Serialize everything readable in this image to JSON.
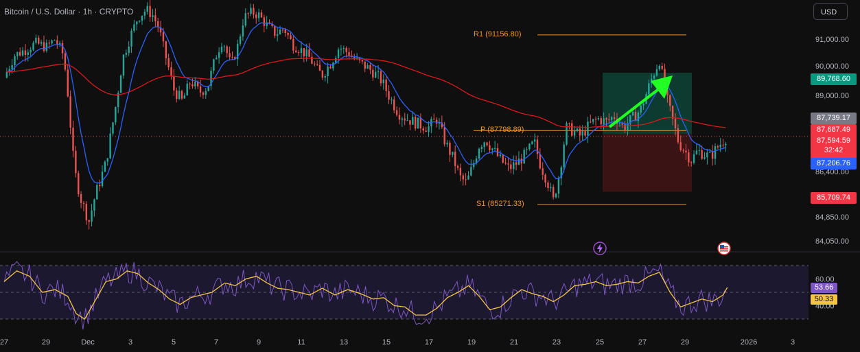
{
  "symbol_title": "Bitcoin / U.S. Dollar · 1h · CRYPTO",
  "currency": "USD",
  "colors": {
    "background": "#0f0f0f",
    "up": "#26a69a",
    "down": "#ef5350",
    "ema_fast": "#2962ff",
    "ema_slow": "#e0181b",
    "pivot": "#f7931a",
    "rsi": "#7e57c2",
    "rsi_ma": "#f5c542",
    "arrow": "#22ff22",
    "target_zone": "#0d3b2f",
    "stop_zone": "#3a1414"
  },
  "price_tags": [
    {
      "value": "89,768.60",
      "color": "#089981"
    },
    {
      "value": "87,739.17",
      "color": "#787b86"
    },
    {
      "value": "87,687.49",
      "color": "#f23645"
    },
    {
      "value": "87,594.59",
      "sub": "32:42",
      "color": "#f23645"
    },
    {
      "value": "87,206.76",
      "color": "#2962ff"
    },
    {
      "value": "85,709.74",
      "color": "#f23645"
    }
  ],
  "rsi_tags": [
    {
      "value": "53.66",
      "color": "#7e57c2"
    },
    {
      "value": "50.33",
      "color": "#f5c542"
    }
  ],
  "pivots": [
    {
      "label": "R1 (91156.80)",
      "price": 91156.8
    },
    {
      "label": "P (87798.89)",
      "price": 87798.89
    },
    {
      "label": "S1 (85271.33)",
      "price": 85271.33
    }
  ],
  "position": {
    "target": 89768.6,
    "entry": 87687.49,
    "stop": 85709.74
  },
  "current_price": 87594.59,
  "icons": [
    "lightning-icon",
    "us-flag-icon"
  ],
  "chart_data": {
    "type": "candlestick",
    "x_ticks": [
      "27",
      "29",
      "Dec",
      "3",
      "5",
      "7",
      "9",
      "11",
      "13",
      "15",
      "17",
      "19",
      "21",
      "23",
      "25",
      "27",
      "29",
      "2026",
      "3"
    ],
    "y_ticks": [
      "91,000.00",
      "90,000.00",
      "89,000.00",
      "86,400.00",
      "84,850.00",
      "84,050.00"
    ],
    "rsi_ticks": [
      "60.00",
      "40.00"
    ],
    "price_path": [
      [
        0,
        89600
      ],
      [
        0.5,
        90400
      ],
      [
        1,
        90600
      ],
      [
        1.5,
        90850
      ],
      [
        2,
        90700
      ],
      [
        2.4,
        91000
      ],
      [
        2.8,
        90400
      ],
      [
        3,
        89100
      ],
      [
        3.3,
        86500
      ],
      [
        3.6,
        85500
      ],
      [
        4,
        84700
      ],
      [
        4.3,
        85600
      ],
      [
        4.8,
        86700
      ],
      [
        5.3,
        88800
      ],
      [
        5.6,
        90300
      ],
      [
        6,
        91200
      ],
      [
        6.3,
        91800
      ],
      [
        6.7,
        92100
      ],
      [
        7,
        91900
      ],
      [
        7.3,
        91400
      ],
      [
        7.6,
        90400
      ],
      [
        8,
        89200
      ],
      [
        8.4,
        88800
      ],
      [
        8.8,
        89500
      ],
      [
        9.2,
        89100
      ],
      [
        9.6,
        89300
      ],
      [
        10,
        90400
      ],
      [
        10.3,
        91000
      ],
      [
        10.7,
        90000
      ],
      [
        11,
        90700
      ],
      [
        11.3,
        91800
      ],
      [
        11.7,
        92000
      ],
      [
        12,
        91900
      ],
      [
        12.4,
        91500
      ],
      [
        12.8,
        91200
      ],
      [
        13.2,
        91400
      ],
      [
        13.6,
        90800
      ],
      [
        14,
        90600
      ],
      [
        14.4,
        90300
      ],
      [
        14.8,
        89800
      ],
      [
        15,
        89700
      ],
      [
        15.4,
        90100
      ],
      [
        15.8,
        90700
      ],
      [
        16.2,
        90500
      ],
      [
        16.6,
        90200
      ],
      [
        17,
        90000
      ],
      [
        17.4,
        89800
      ],
      [
        17.8,
        89500
      ],
      [
        18.2,
        88900
      ],
      [
        18.6,
        88400
      ],
      [
        19,
        88200
      ],
      [
        19.3,
        88100
      ],
      [
        19.6,
        88000
      ],
      [
        20,
        87900
      ],
      [
        20.4,
        88200
      ],
      [
        20.8,
        87400
      ],
      [
        21.2,
        86800
      ],
      [
        21.5,
        86200
      ],
      [
        21.8,
        86000
      ],
      [
        22.1,
        86600
      ],
      [
        22.4,
        87300
      ],
      [
        22.7,
        87500
      ],
      [
        23,
        87200
      ],
      [
        23.4,
        86800
      ],
      [
        23.8,
        86500
      ],
      [
        24.2,
        86700
      ],
      [
        24.6,
        87000
      ],
      [
        25,
        87400
      ],
      [
        25.3,
        86600
      ],
      [
        25.6,
        86100
      ],
      [
        25.9,
        85400
      ],
      [
        26.2,
        86400
      ],
      [
        26.5,
        87900
      ],
      [
        26.8,
        87800
      ],
      [
        27.2,
        87600
      ],
      [
        27.6,
        88000
      ],
      [
        28,
        88200
      ],
      [
        28.4,
        88100
      ],
      [
        28.8,
        88300
      ],
      [
        29.2,
        87900
      ],
      [
        29.6,
        88200
      ],
      [
        30,
        88500
      ],
      [
        30.3,
        89100
      ],
      [
        30.6,
        89700
      ],
      [
        30.9,
        90200
      ],
      [
        31.2,
        89000
      ],
      [
        31.5,
        88200
      ],
      [
        31.8,
        87400
      ],
      [
        32.1,
        87100
      ],
      [
        32.4,
        86800
      ],
      [
        32.7,
        87100
      ],
      [
        33,
        87000
      ],
      [
        33.3,
        86900
      ],
      [
        33.6,
        87200
      ],
      [
        33.9,
        87450
      ],
      [
        34.1,
        87600
      ]
    ],
    "rsi_path": [
      [
        0,
        58
      ],
      [
        0.6,
        66
      ],
      [
        1.2,
        62
      ],
      [
        1.8,
        50
      ],
      [
        2.4,
        52
      ],
      [
        3,
        47
      ],
      [
        3.4,
        34
      ],
      [
        3.8,
        30
      ],
      [
        4.3,
        44
      ],
      [
        4.8,
        58
      ],
      [
        5.3,
        60
      ],
      [
        5.8,
        66
      ],
      [
        6.3,
        64
      ],
      [
        6.8,
        57
      ],
      [
        7.3,
        52
      ],
      [
        7.8,
        45
      ],
      [
        8.3,
        41
      ],
      [
        8.8,
        46
      ],
      [
        9.3,
        48
      ],
      [
        9.8,
        50
      ],
      [
        10.4,
        57
      ],
      [
        10.9,
        55
      ],
      [
        11.4,
        60
      ],
      [
        11.9,
        62
      ],
      [
        12.4,
        57
      ],
      [
        12.9,
        53
      ],
      [
        13.4,
        52
      ],
      [
        13.9,
        50
      ],
      [
        14.4,
        48
      ],
      [
        15,
        53
      ],
      [
        15.6,
        48
      ],
      [
        16.2,
        52
      ],
      [
        16.8,
        49
      ],
      [
        17.4,
        45
      ],
      [
        17.9,
        46
      ],
      [
        18.4,
        40
      ],
      [
        18.9,
        39
      ],
      [
        19.4,
        33
      ],
      [
        19.9,
        33
      ],
      [
        20.4,
        38
      ],
      [
        20.9,
        46
      ],
      [
        21.4,
        50
      ],
      [
        21.9,
        55
      ],
      [
        22.4,
        47
      ],
      [
        22.9,
        37
      ],
      [
        23.4,
        39
      ],
      [
        23.9,
        46
      ],
      [
        24.4,
        52
      ],
      [
        24.9,
        49
      ],
      [
        25.4,
        47
      ],
      [
        25.9,
        43
      ],
      [
        26.4,
        48
      ],
      [
        26.9,
        55
      ],
      [
        27.4,
        56
      ],
      [
        27.9,
        58
      ],
      [
        28.4,
        55
      ],
      [
        28.9,
        56
      ],
      [
        29.4,
        58
      ],
      [
        29.9,
        57
      ],
      [
        30.4,
        62
      ],
      [
        30.9,
        65
      ],
      [
        31.4,
        50
      ],
      [
        31.9,
        39
      ],
      [
        32.4,
        42
      ],
      [
        32.9,
        45
      ],
      [
        33.4,
        43
      ],
      [
        33.9,
        48
      ],
      [
        34.1,
        53.66
      ]
    ]
  }
}
